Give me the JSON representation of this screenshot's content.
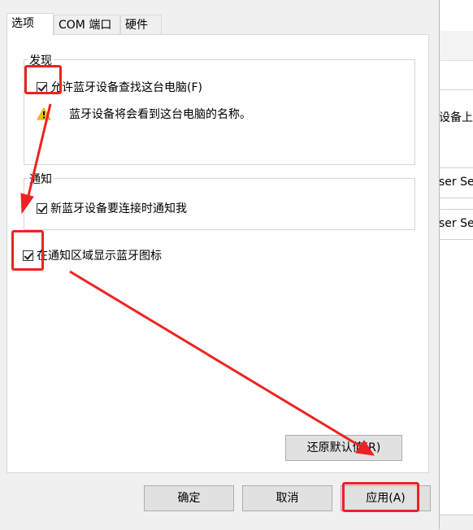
{
  "tabs": [
    {
      "label": "选项"
    },
    {
      "label": "COM 端口"
    },
    {
      "label": "硬件"
    }
  ],
  "discover": {
    "group_label": "发现",
    "allow_label": "允许蓝牙设备查找这台电脑(F)",
    "allow_checked": true,
    "warning_text": "蓝牙设备将会看到这台电脑的名称。"
  },
  "notify": {
    "group_label": "通知",
    "new_device_label": "新蓝牙设备要连接时通知我",
    "new_device_checked": true
  },
  "tray": {
    "label": "在通知区域显示蓝牙图标",
    "checked": true
  },
  "buttons": {
    "restore": "还原默认值(R)",
    "ok": "确定",
    "cancel": "取消",
    "apply": "应用(A)"
  },
  "background": {
    "text_1": "设备上",
    "text_2": "ser Se",
    "text_3": "ser Se"
  },
  "colors": {
    "annotation": "#ee2222",
    "warning": "#f5c400"
  }
}
